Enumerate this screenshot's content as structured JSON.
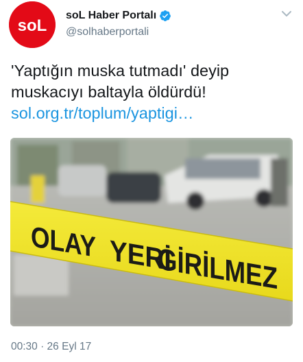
{
  "account": {
    "display_name": "soL Haber Portalı",
    "handle": "@solhaberportali",
    "avatar_text": "soL",
    "verified": true,
    "verified_icon": "verified-badge-icon",
    "brand_color": "#e30a17"
  },
  "tweet": {
    "text_line_1": "'Yaptığın muska tutmadı' deyip",
    "text_line_2": "muskacıyı baltayla öldürdü!",
    "link": "sol.org.tr/toplum/yaptigi…",
    "link_color": "#1b95e0"
  },
  "media": {
    "tape_word_1": "OLAY",
    "tape_word_2": "YERİ",
    "tape_word_3": "GİRİLMEZ",
    "tape_color": "#f2e52b"
  },
  "meta": {
    "timestamp": "00:30 · 26 Eyl 17"
  },
  "menu": {
    "icon": "chevron-down-icon"
  }
}
